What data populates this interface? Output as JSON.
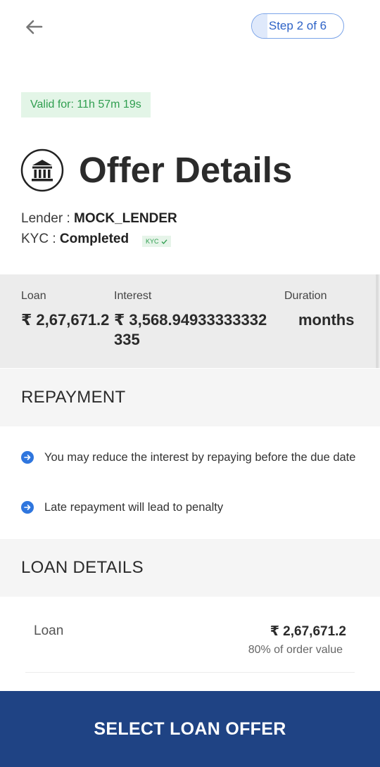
{
  "header": {
    "back_icon": "arrow-left-icon",
    "step_label": "Step 2 of 6",
    "step_progress": 0.17
  },
  "validity": {
    "text": "Valid for: 11h 57m 19s"
  },
  "title": {
    "icon": "bank-icon",
    "text": "Offer Details"
  },
  "lender": {
    "label": "Lender : ",
    "value": "MOCK_LENDER"
  },
  "kyc": {
    "label": "KYC : ",
    "value": "Completed",
    "badge": "KYC",
    "badge_icon": "check-icon"
  },
  "summary": {
    "loan_label": "Loan",
    "loan_value": "₹ 2,67,671.2",
    "interest_label": "Interest",
    "interest_value_line1": "₹ 3,568.94933333332",
    "interest_value_line2": "335",
    "duration_label": "Duration",
    "duration_value": "months"
  },
  "repayment": {
    "title": "REPAYMENT",
    "bullet_icon": "arrow-right-circle-icon",
    "items": [
      "You may reduce the interest by repaying before the due date",
      "Late repayment will lead to penalty"
    ]
  },
  "loan_details": {
    "title": "LOAN DETAILS",
    "loan_label": "Loan",
    "loan_amount": "₹ 2,67,671.2",
    "loan_sub": "80% of order value"
  },
  "cta": {
    "label": "SELECT LOAN OFFER"
  },
  "colors": {
    "primary": "#1f4384",
    "accent_blue": "#2f76de",
    "valid_green": "#2f9e4f"
  }
}
